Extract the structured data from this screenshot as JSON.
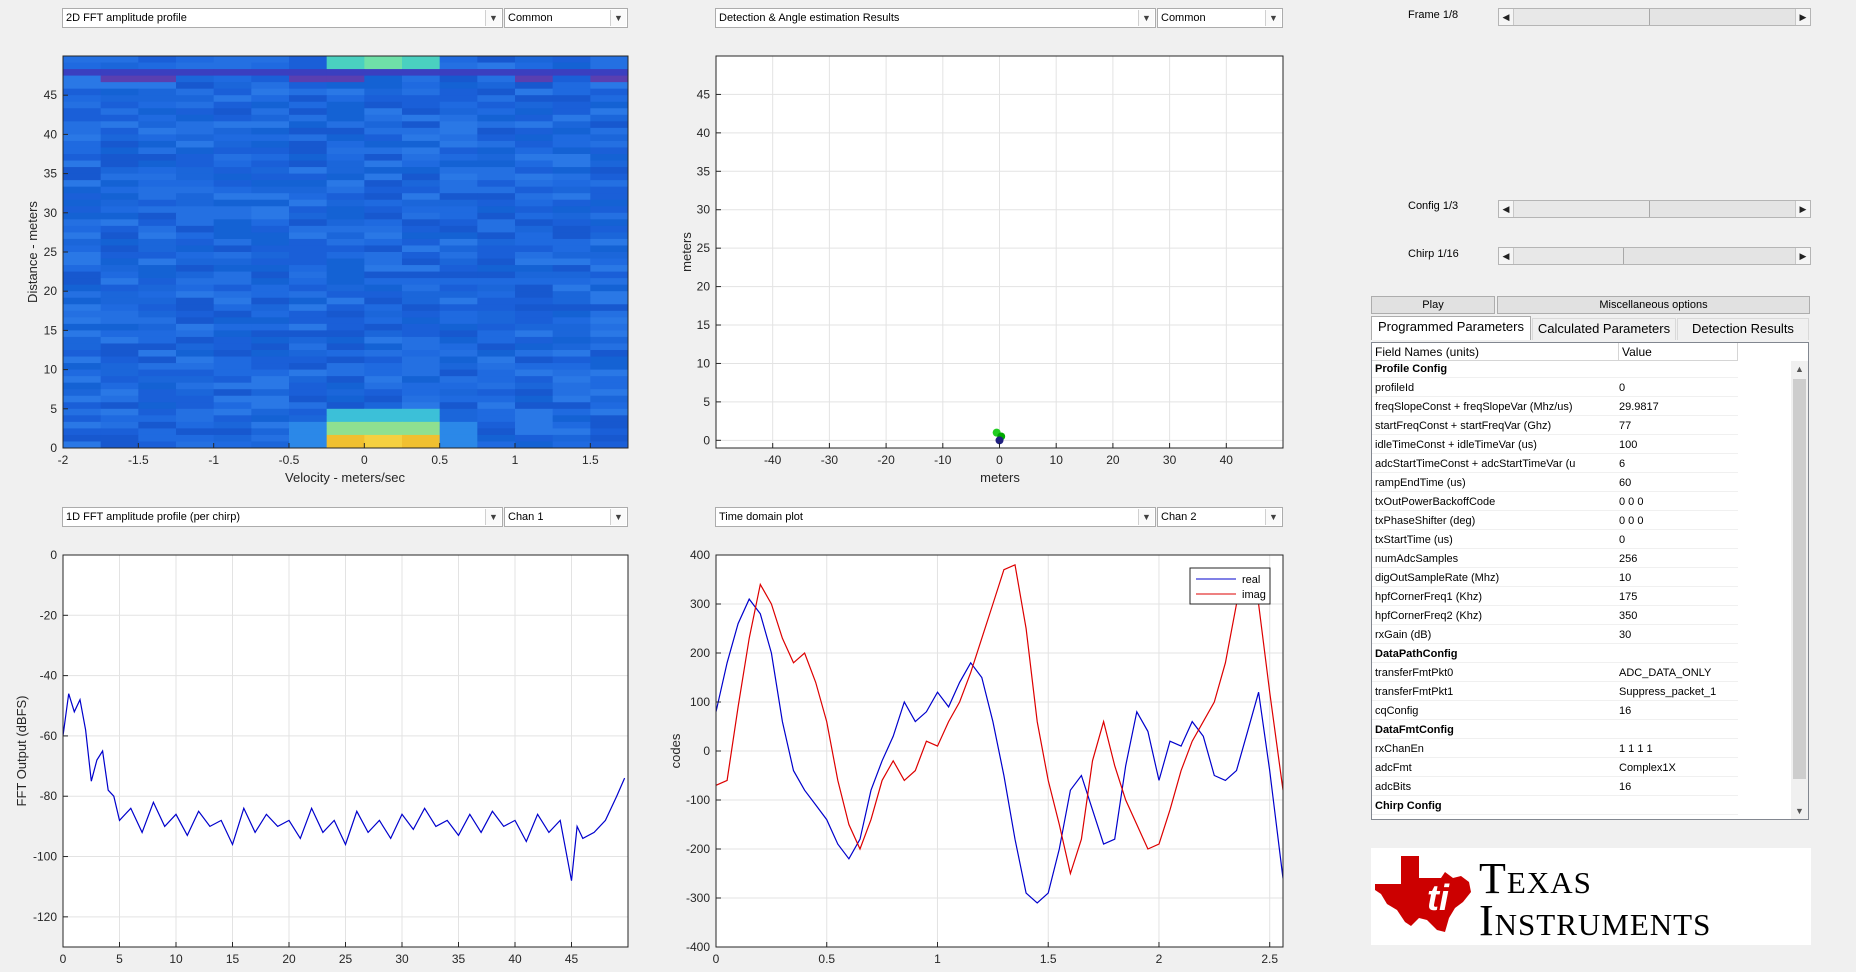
{
  "panels": {
    "p1": {
      "dropdown": "2D FFT amplitude profile",
      "mode": "Common",
      "xlabel": "Velocity - meters/sec",
      "ylabel": "Distance - meters"
    },
    "p2": {
      "dropdown": "Detection & Angle estimation Results",
      "mode": "Common",
      "xlabel": "meters",
      "ylabel": "meters"
    },
    "p3": {
      "dropdown": "1D FFT amplitude profile (per chirp)",
      "mode": "Chan 1",
      "xlabel": "",
      "ylabel": "FFT Output (dBFS)"
    },
    "p4": {
      "dropdown": "Time domain plot",
      "mode": "Chan 2",
      "xlabel": "",
      "ylabel": "codes"
    }
  },
  "controls": {
    "frame_label": "Frame 1/8",
    "config_label": "Config 1/3",
    "chirp_label": "Chirp 1/16",
    "frame_value": 0.48,
    "config_value": 0.48,
    "chirp_value": 0.39,
    "play_label": "Play",
    "misc_label": "Miscellaneous options"
  },
  "tabs": [
    "Programmed Parameters",
    "Calculated Parameters",
    "Detection Results"
  ],
  "table": {
    "col1": "Field Names    (units)",
    "col2": "Value",
    "rows": [
      {
        "name": "Profile Config",
        "value": "",
        "section": true
      },
      {
        "name": "profileId",
        "value": "0"
      },
      {
        "name": "freqSlopeConst + freqSlopeVar (Mhz/us)",
        "value": "29.9817"
      },
      {
        "name": "startFreqConst + startFreqVar (Ghz)",
        "value": "77"
      },
      {
        "name": "idleTimeConst + idleTimeVar (us)",
        "value": "100"
      },
      {
        "name": "adcStartTimeConst + adcStartTimeVar (us)",
        "value": "6"
      },
      {
        "name": "rampEndTime (us)",
        "value": "60"
      },
      {
        "name": "txOutPowerBackoffCode",
        "value": "0 0 0"
      },
      {
        "name": "txPhaseShifter (deg)",
        "value": "0 0 0"
      },
      {
        "name": "txStartTime (us)",
        "value": "0"
      },
      {
        "name": "numAdcSamples",
        "value": "256"
      },
      {
        "name": "digOutSampleRate (Mhz)",
        "value": "10"
      },
      {
        "name": "hpfCornerFreq1 (Khz)",
        "value": "175"
      },
      {
        "name": "hpfCornerFreq2 (Khz)",
        "value": "350"
      },
      {
        "name": "rxGain (dB)",
        "value": "30"
      },
      {
        "name": "DataPathConfig",
        "value": "",
        "section": true
      },
      {
        "name": "transferFmtPkt0",
        "value": "ADC_DATA_ONLY"
      },
      {
        "name": "transferFmtPkt1",
        "value": "Suppress_packet_1"
      },
      {
        "name": "cqConfig",
        "value": "16"
      },
      {
        "name": "DataFmtConfig",
        "value": "",
        "section": true
      },
      {
        "name": "rxChanEn",
        "value": "1 1 1 1"
      },
      {
        "name": "adcFmt",
        "value": "Complex1X"
      },
      {
        "name": "adcBits",
        "value": "16"
      },
      {
        "name": "Chirp Config",
        "value": "",
        "section": true
      }
    ]
  },
  "logo": {
    "line1": "Texas",
    "line2": "Instruments",
    "color": "#cc0000"
  },
  "chart_data": [
    {
      "type": "heatmap",
      "xlabel": "Velocity - meters/sec",
      "ylabel": "Distance - meters",
      "xticks": [
        "-2",
        "-1.5",
        "-1",
        "-0.5",
        "0",
        "0.5",
        "1",
        "1.5"
      ],
      "yticks": [
        "0",
        "5",
        "10",
        "15",
        "20",
        "25",
        "30",
        "35",
        "40",
        "45"
      ],
      "xlim": [
        -2,
        1.75
      ],
      "ylim": [
        0,
        50
      ]
    },
    {
      "type": "scatter",
      "xlabel": "meters",
      "ylabel": "meters",
      "xticks": [
        "-40",
        "-30",
        "-20",
        "-10",
        "0",
        "10",
        "20",
        "30",
        "40"
      ],
      "yticks": [
        "0",
        "5",
        "10",
        "15",
        "20",
        "25",
        "30",
        "35",
        "40",
        "45"
      ],
      "xlim": [
        -50,
        50
      ],
      "ylim": [
        -1,
        50
      ],
      "points": [
        {
          "x": -0.5,
          "y": 1,
          "color": "#22cc22"
        },
        {
          "x": 0.3,
          "y": 0.5,
          "color": "#00aa00"
        },
        {
          "x": 0,
          "y": 0,
          "color": "#202080"
        }
      ],
      "grid": true
    },
    {
      "type": "line",
      "ylabel": "FFT Output (dBFS)",
      "xticks": [
        "0",
        "5",
        "10",
        "15",
        "20",
        "25",
        "30",
        "35",
        "40",
        "45"
      ],
      "yticks": [
        "0",
        "-20",
        "-40",
        "-60",
        "-80",
        "-100",
        "-120"
      ],
      "xlim": [
        0,
        50
      ],
      "ylim": [
        -130,
        0
      ],
      "grid": true,
      "series": [
        {
          "color": "#0000cc",
          "x": [
            0,
            0.5,
            1,
            1.5,
            2,
            2.5,
            3,
            3.5,
            4,
            4.5,
            5,
            6,
            7,
            8,
            9,
            10,
            11,
            12,
            13,
            14,
            15,
            16,
            17,
            18,
            19,
            20,
            21,
            22,
            23,
            24,
            25,
            26,
            27,
            28,
            29,
            30,
            31,
            32,
            33,
            34,
            35,
            36,
            37,
            38,
            39,
            40,
            41,
            42,
            43,
            44,
            45,
            45.5,
            46,
            47,
            48,
            49,
            49.7
          ],
          "values": [
            -60,
            -46,
            -52,
            -48,
            -58,
            -75,
            -68,
            -65,
            -78,
            -80,
            -88,
            -84,
            -92,
            -82,
            -90,
            -86,
            -93,
            -85,
            -90,
            -88,
            -96,
            -84,
            -92,
            -86,
            -90,
            -88,
            -94,
            -84,
            -92,
            -88,
            -96,
            -85,
            -92,
            -88,
            -94,
            -86,
            -91,
            -84,
            -90,
            -88,
            -93,
            -86,
            -92,
            -85,
            -90,
            -88,
            -95,
            -86,
            -92,
            -88,
            -108,
            -90,
            -94,
            -92,
            -88,
            -80,
            -74
          ]
        }
      ]
    },
    {
      "type": "line",
      "ylabel": "codes",
      "xticks": [
        "0",
        "0.5",
        "1",
        "1.5",
        "2",
        "2.5"
      ],
      "yticks": [
        "400",
        "300",
        "200",
        "100",
        "0",
        "-100",
        "-200",
        "-300",
        "-400"
      ],
      "xlim": [
        0,
        2.56
      ],
      "ylim": [
        -400,
        400
      ],
      "grid": true,
      "legend": "top-right",
      "series": [
        {
          "name": "real",
          "color": "#0000cc",
          "x": [
            0,
            0.05,
            0.1,
            0.15,
            0.2,
            0.25,
            0.3,
            0.35,
            0.4,
            0.45,
            0.5,
            0.55,
            0.6,
            0.65,
            0.7,
            0.75,
            0.8,
            0.85,
            0.9,
            0.95,
            1.0,
            1.05,
            1.1,
            1.15,
            1.2,
            1.25,
            1.3,
            1.35,
            1.4,
            1.45,
            1.5,
            1.55,
            1.6,
            1.65,
            1.7,
            1.75,
            1.8,
            1.85,
            1.9,
            1.95,
            2.0,
            2.05,
            2.1,
            2.15,
            2.2,
            2.25,
            2.3,
            2.35,
            2.4,
            2.45,
            2.5,
            2.56
          ],
          "values": [
            80,
            180,
            260,
            310,
            280,
            200,
            60,
            -40,
            -80,
            -110,
            -140,
            -190,
            -220,
            -180,
            -80,
            -20,
            30,
            100,
            60,
            80,
            120,
            90,
            140,
            180,
            150,
            60,
            -50,
            -180,
            -290,
            -310,
            -290,
            -200,
            -80,
            -50,
            -120,
            -190,
            -180,
            -30,
            80,
            40,
            -60,
            20,
            10,
            60,
            30,
            -50,
            -60,
            -40,
            40,
            120,
            -40,
            -260
          ]
        },
        {
          "name": "imag",
          "color": "#dd0000",
          "x": [
            0,
            0.05,
            0.1,
            0.15,
            0.2,
            0.25,
            0.3,
            0.35,
            0.4,
            0.45,
            0.5,
            0.55,
            0.6,
            0.65,
            0.7,
            0.75,
            0.8,
            0.85,
            0.9,
            0.95,
            1.0,
            1.05,
            1.1,
            1.15,
            1.2,
            1.25,
            1.3,
            1.35,
            1.4,
            1.45,
            1.5,
            1.55,
            1.6,
            1.65,
            1.7,
            1.75,
            1.8,
            1.85,
            1.9,
            1.95,
            2.0,
            2.05,
            2.1,
            2.15,
            2.2,
            2.25,
            2.3,
            2.35,
            2.4,
            2.45,
            2.5,
            2.56
          ],
          "values": [
            -70,
            -60,
            90,
            230,
            340,
            300,
            230,
            180,
            200,
            140,
            60,
            -60,
            -150,
            -200,
            -140,
            -60,
            -20,
            -60,
            -40,
            20,
            10,
            60,
            100,
            160,
            230,
            300,
            370,
            380,
            250,
            60,
            -60,
            -150,
            -250,
            -180,
            -20,
            60,
            -30,
            -100,
            -150,
            -200,
            -190,
            -120,
            -40,
            20,
            60,
            100,
            180,
            300,
            350,
            300,
            120,
            -80
          ]
        }
      ]
    }
  ]
}
